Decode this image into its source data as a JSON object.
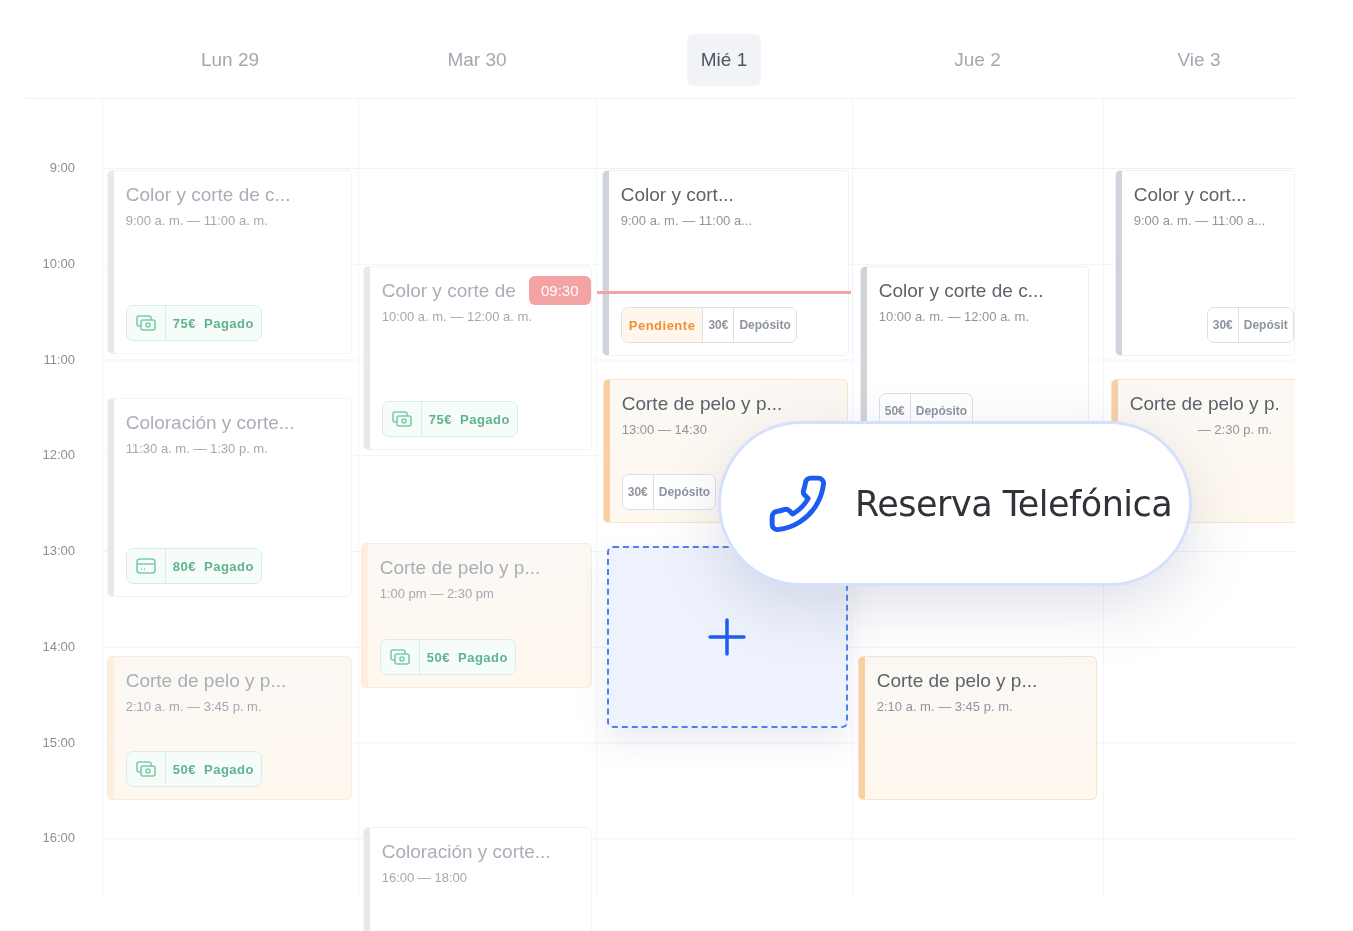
{
  "days": [
    {
      "label": "Lun 29",
      "selected": false,
      "events": [
        {
          "kind": "appointment",
          "title": "Color y corte de c...",
          "time": "9:00 a. m. — 11:00 a. m.",
          "color": "#e6e8eb",
          "dimmed": true,
          "badges": [
            {
              "kind": "cash"
            },
            {
              "kind": "paid",
              "text": "75€ Pagado"
            }
          ]
        },
        {
          "kind": "appointment",
          "title": "Coloración y corte...",
          "time": "11:30 a. m. — 1:30 p. m.",
          "color": "#e6e8eb",
          "dimmed": true,
          "badges": [
            {
              "kind": "card"
            },
            {
              "kind": "paid",
              "text": "80€ Pagado"
            }
          ]
        },
        {
          "kind": "appointment",
          "title": "Corte de pelo y p...",
          "time": "2:10 a. m. — 3:45 p. m.",
          "color": "#fdeedd",
          "dimmed": true,
          "badges": [
            {
              "kind": "cash"
            },
            {
              "kind": "paid",
              "text": "50€ Pagado"
            }
          ]
        }
      ]
    },
    {
      "label": "Mar 30",
      "selected": false,
      "events": [
        {
          "kind": "appointment",
          "title": "Color y corte de",
          "time": "10:00 a. m. — 12:00 a. m.",
          "color": "#e6e8eb",
          "dimmed": true,
          "badges": [
            {
              "kind": "cash"
            },
            {
              "kind": "paid",
              "text": "75€ Pagado"
            }
          ]
        },
        {
          "kind": "appointment",
          "title": "Corte de pelo y p...",
          "time": "1:00 pm — 2:30 pm",
          "color": "#fdeedd",
          "dimmed": true,
          "badges": [
            {
              "kind": "cash"
            },
            {
              "kind": "paid",
              "text": "50€ Pagado"
            }
          ]
        },
        {
          "kind": "appointment",
          "title": "Coloración y corte...",
          "time": "16:00 — 18:00",
          "color": "#e6e8eb",
          "dimmed": true
        }
      ]
    },
    {
      "label": "Mié 1",
      "selected": true,
      "events": [
        {
          "kind": "appointment",
          "title": "Color y cort...",
          "time": "9:00 a. m. — 11:00 a...",
          "color": "#cfd4da",
          "dimmed": false,
          "badges": [
            {
              "kind": "status",
              "text": "Pendiente"
            },
            {
              "kind": "amount",
              "text": "30€"
            },
            {
              "kind": "amount",
              "text": "Depósito"
            }
          ]
        },
        {
          "kind": "appointment",
          "title": "Corte de pelo y p...",
          "time": "13:00 — 14:30",
          "color": "#f9cfa4",
          "dimmed": false,
          "badges": [
            {
              "kind": "amount",
              "text": "30€"
            },
            {
              "kind": "amount",
              "text": "Depósito"
            }
          ]
        },
        {
          "kind": "new-slot"
        }
      ]
    },
    {
      "label": "Jue 2",
      "selected": false,
      "events": [
        {
          "kind": "appointment",
          "title": "Color y corte de c...",
          "time": "10:00 a. m. — 12:00 a. m.",
          "color": "#cfd4da",
          "dimmed": false,
          "badges": [
            {
              "kind": "amount",
              "text": "50€"
            },
            {
              "kind": "amount",
              "text": "Depósito"
            }
          ]
        },
        {
          "kind": "appointment",
          "title": "Corte de pelo y p...",
          "time": "2:10 a. m. — 3:45 p. m.",
          "color": "#f9cfa4",
          "dimmed": false
        }
      ]
    },
    {
      "label": "Vie 3",
      "selected": false,
      "events": [
        {
          "kind": "appointment",
          "title": "Color y cort...",
          "time": "9:00 a. m. — 11:00 a...",
          "color": "#cfd4da",
          "dimmed": false,
          "badges": [
            {
              "kind": "amount",
              "text": "30€"
            },
            {
              "kind": "amount",
              "text": "Depósit"
            }
          ]
        },
        {
          "kind": "appointment",
          "title": "Corte de pelo y p.",
          "time": "— 2:30 p. m.",
          "color": "#f9cfa4",
          "dimmed": false
        }
      ]
    }
  ],
  "hours": [
    "9:00",
    "10:00",
    "11:00",
    "12:00",
    "13:00",
    "14:00",
    "15:00",
    "16:00"
  ],
  "now_marker": {
    "time": "09:30"
  },
  "popup": {
    "label": "Reserva Telefónica"
  }
}
